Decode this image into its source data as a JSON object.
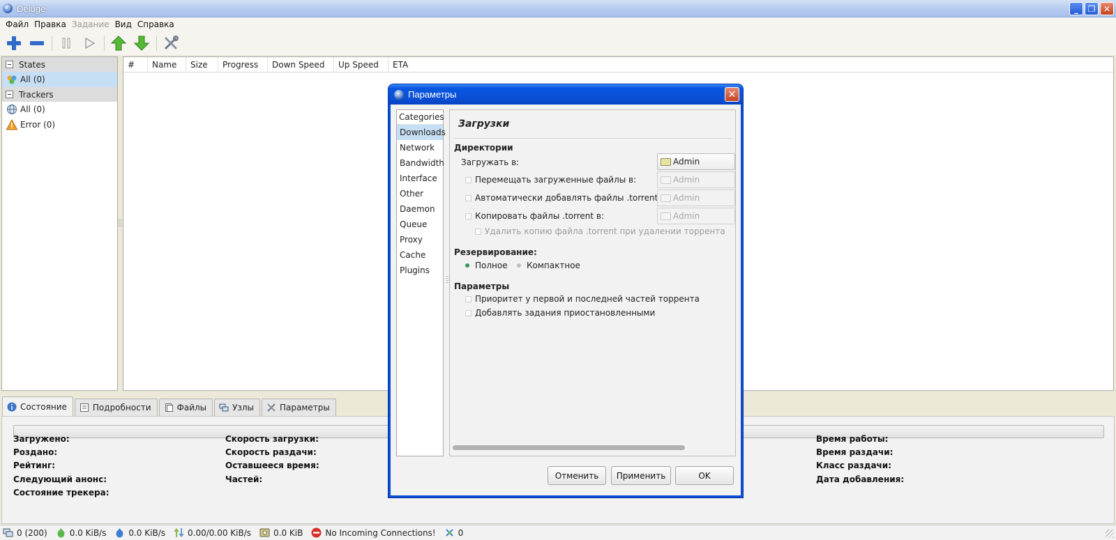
{
  "window": {
    "title": "Deluge"
  },
  "menu": [
    "Файл",
    "Правка",
    "Задание",
    "Вид",
    "Справка"
  ],
  "sidebar": {
    "states_header": "States",
    "state_items": [
      {
        "label": "All (0)",
        "icon": "all-states-icon"
      }
    ],
    "trackers_header": "Trackers",
    "tracker_items": [
      {
        "label": "All (0)",
        "icon": "globe-icon"
      },
      {
        "label": "Error (0)",
        "icon": "warning-icon"
      }
    ]
  },
  "columns": [
    "#",
    "Name",
    "Size",
    "Progress",
    "Down Speed",
    "Up Speed",
    "ETA"
  ],
  "tabs": [
    "Состояние",
    "Подробности",
    "Файлы",
    "Узлы",
    "Параметры"
  ],
  "details": {
    "downloaded": "Загружено:",
    "uploaded": "Роздано:",
    "ratio": "Рейтинг:",
    "next_announce": "Следующий анонс:",
    "tracker_status": "Состояние трекера:",
    "down_speed": "Скорость загрузки:",
    "up_speed": "Скорость раздачи:",
    "eta": "Оставшееся время:",
    "pieces": "Частей:",
    "active_time": "Время работы:",
    "seeding_time": "Время раздачи:",
    "seed_rank": "Класс раздачи:",
    "date_added": "Дата добавления:"
  },
  "statusbar": {
    "connections": "0 (200)",
    "down": "0.0 KiB/s",
    "up": "0.0 KiB/s",
    "protocol": "0.00/0.00 KiB/s",
    "free_space": "0.0 KiB",
    "incoming": "No Incoming Connections!",
    "dht": "0"
  },
  "dialog": {
    "title": "Параметры",
    "categories_header": "Categories",
    "categories": [
      "Downloads",
      "Network",
      "Bandwidth",
      "Interface",
      "Other",
      "Daemon",
      "Queue",
      "Proxy",
      "Cache",
      "Plugins"
    ],
    "pane_title": "Загрузки",
    "folders_section": "Директории",
    "download_to": "Загружать в:",
    "move_completed": "Перемещать загруженные файлы в:",
    "autoadd": "Автоматически добавлять файлы .torrent из:",
    "copy_torrent": "Копировать файлы .torrent в:",
    "delete_copy": "Удалить копию файла .torrent при удалении торрента",
    "folder_value": "Admin",
    "allocation_section": "Резервирование:",
    "full": "Полное",
    "compact": "Компактное",
    "options_section": "Параметры",
    "prioritize": "Приоритет у первой и последней частей торрента",
    "add_paused": "Добавлять задания приостановленными",
    "cancel": "Отменить",
    "apply": "Применить",
    "ok": "OK"
  },
  "colors": {
    "selection": "#c7dff4",
    "dialog_border": "#0a4fd6",
    "radio_active": "#2d9c50"
  }
}
